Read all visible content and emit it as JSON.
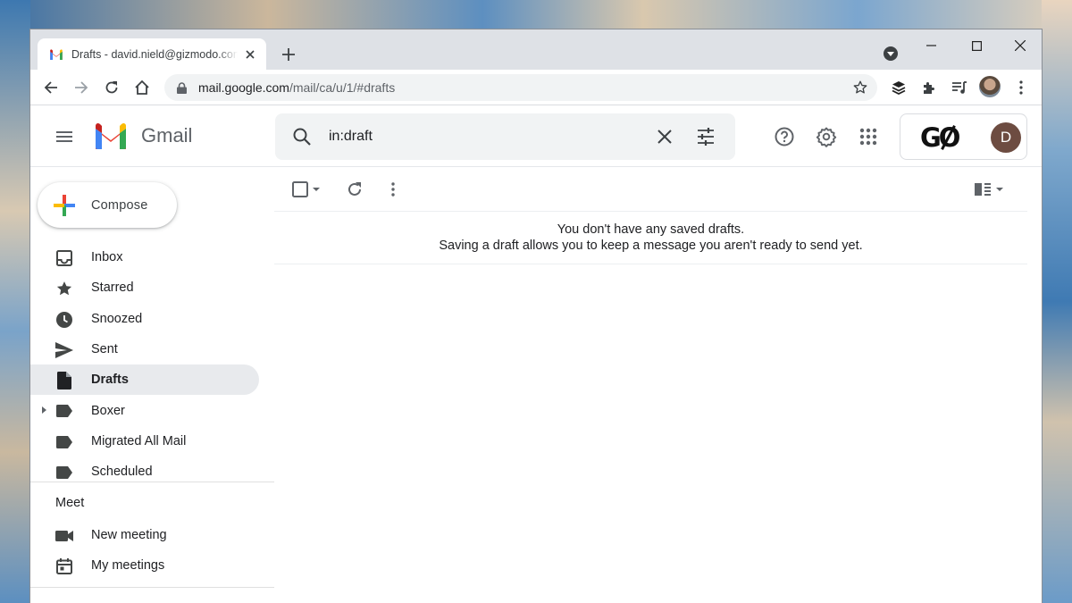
{
  "browser": {
    "tab_title": "Drafts - david.nield@gizmodo.com",
    "url_host": "mail.google.com",
    "url_path": "/mail/ca/u/1/#drafts"
  },
  "gmail": {
    "product_name": "Gmail",
    "search_value": "in:draft",
    "account_initial": "D",
    "account_logo": "GO",
    "compose_label": "Compose",
    "nav_items": [
      {
        "label": "Inbox",
        "icon": "inbox-icon"
      },
      {
        "label": "Starred",
        "icon": "star-icon"
      },
      {
        "label": "Snoozed",
        "icon": "clock-icon"
      },
      {
        "label": "Sent",
        "icon": "send-icon"
      },
      {
        "label": "Drafts",
        "icon": "draft-icon",
        "active": true
      },
      {
        "label": "Boxer",
        "icon": "label-icon"
      },
      {
        "label": "Migrated All Mail",
        "icon": "label-icon"
      },
      {
        "label": "Scheduled",
        "icon": "label-icon"
      }
    ],
    "meet": {
      "heading": "Meet",
      "items": [
        {
          "label": "New meeting",
          "icon": "video-camera-icon"
        },
        {
          "label": "My meetings",
          "icon": "calendar-icon"
        }
      ]
    },
    "empty_state": {
      "line1": "You don't have any saved drafts.",
      "line2": "Saving a draft allows you to keep a message you aren't ready to send yet."
    }
  },
  "colors": {
    "accent_red": "#ea4335",
    "accent_blue": "#4285f4",
    "accent_yellow": "#fbbc04",
    "accent_green": "#34a853",
    "active_nav_bg": "#e8eaed",
    "avatar_bg": "#6d4c41"
  }
}
